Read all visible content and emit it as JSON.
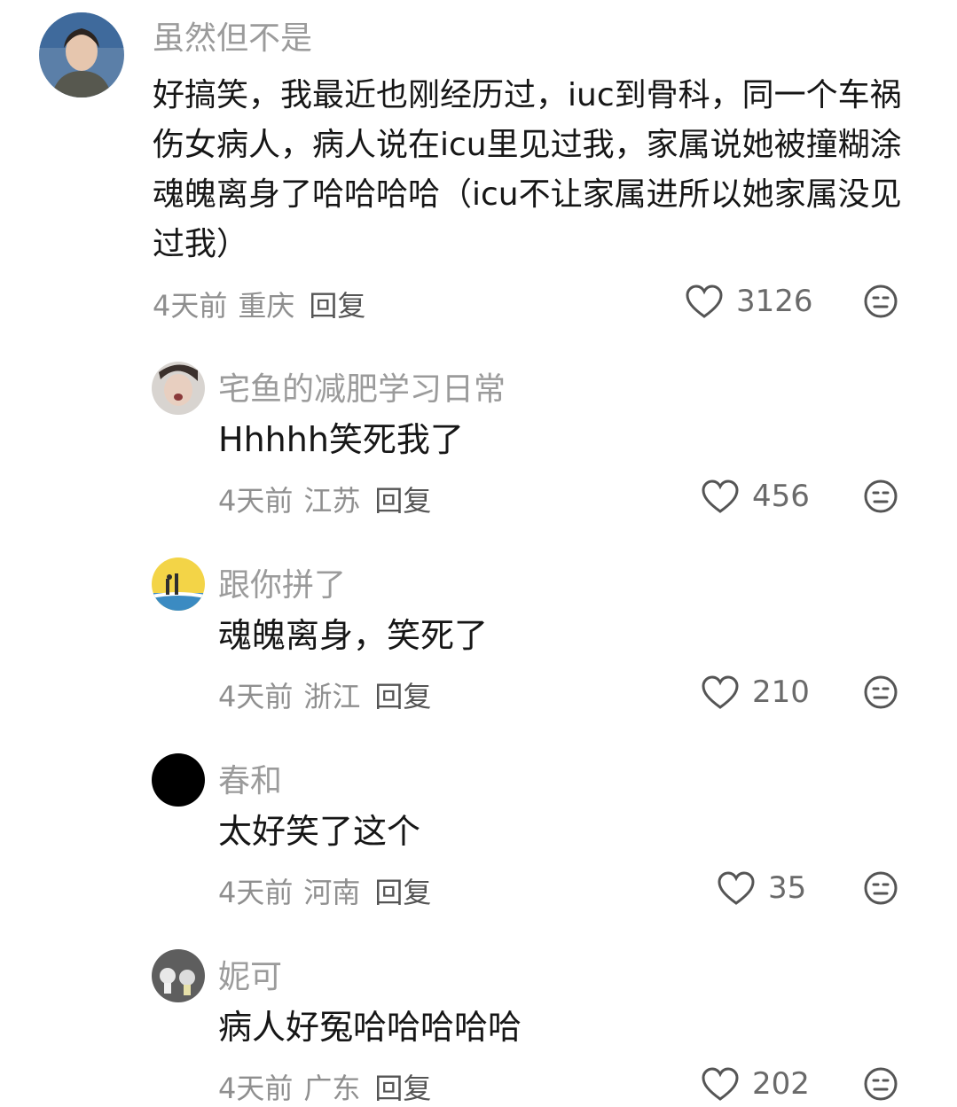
{
  "comments": [
    {
      "username": "虽然但不是",
      "text": "好搞笑，我最近也刚经历过，iuc到骨科，同一个车祸伤女病人，病人说在icu里见过我，家属说她被撞糊涂魂魄离身了哈哈哈哈（icu不让家属进所以她家属没见过我）",
      "time": "4天前",
      "location": "重庆",
      "reply_label": "回复",
      "likes": "3126"
    },
    {
      "username": "宅鱼的减肥学习日常",
      "text": "Hhhhh笑死我了",
      "time": "4天前",
      "location": "江苏",
      "reply_label": "回复",
      "likes": "456"
    },
    {
      "username": "跟你拼了",
      "text": "魂魄离身，笑死了",
      "time": "4天前",
      "location": "浙江",
      "reply_label": "回复",
      "likes": "210"
    },
    {
      "username": "春和",
      "text": "太好笑了这个",
      "time": "4天前",
      "location": "河南",
      "reply_label": "回复",
      "likes": "35"
    },
    {
      "username": "妮可",
      "text": "病人好冤哈哈哈哈哈",
      "time": "4天前",
      "location": "广东",
      "reply_label": "回复",
      "likes": "202"
    }
  ]
}
